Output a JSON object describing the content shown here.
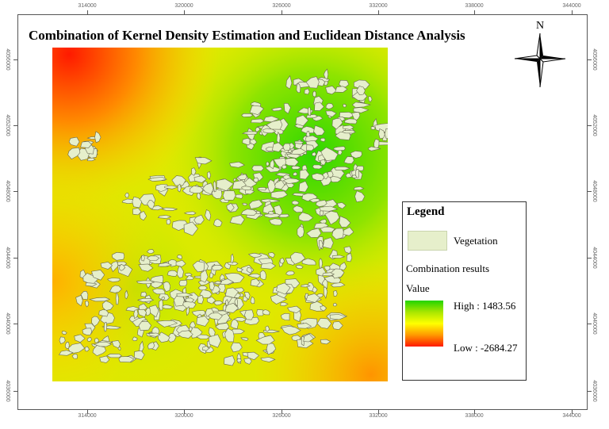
{
  "title": "Combination of Kernel Density Estimation and Euclidean Distance Analysis",
  "x_ticks": [
    "314000",
    "320000",
    "326000",
    "332000",
    "338000",
    "344000"
  ],
  "y_ticks": [
    "4056000",
    "4052000",
    "4048000",
    "4044000",
    "4040000",
    "4036000"
  ],
  "north_arrow": {
    "label": "N",
    "icon": "north-arrow-icon"
  },
  "legend": {
    "title": "Legend",
    "vegetation_label": "Vegetation",
    "combination_label": "Combination results",
    "value_label": "Value",
    "high_label": "High : 1483.56",
    "low_label": "Low : -2684.27"
  },
  "colors": {
    "high": "#22d400",
    "mid": "#ffff00",
    "low": "#ff1a00",
    "vegetation": "#e6efcb"
  }
}
